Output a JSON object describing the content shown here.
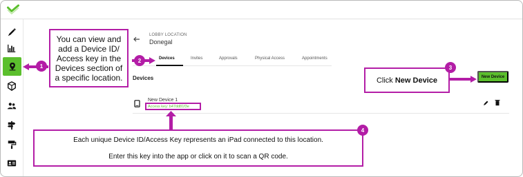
{
  "header": {
    "location_label": "LOBBY LOCATION",
    "location_name": "Donegal"
  },
  "tabs": [
    {
      "label": "Devices"
    },
    {
      "label": "Invites"
    },
    {
      "label": "Approvals"
    },
    {
      "label": "Physical Access"
    },
    {
      "label": "Appointments"
    }
  ],
  "devices": {
    "section_title": "Devices",
    "new_button": "New Device",
    "items": [
      {
        "name": "New Device 1",
        "access_key": "Access key: b47dd81f3e"
      }
    ]
  },
  "callouts": {
    "one": {
      "number": "1",
      "text": "You can view and add a Device ID/ Access key in the Devices section of a specific location."
    },
    "two": {
      "number": "2"
    },
    "three": {
      "number": "3",
      "prefix": "Click ",
      "strong": "New Device"
    },
    "four": {
      "number": "4",
      "line1": "Each unique Device ID/Access Key represents an iPad connected to this location.",
      "line2": "Enter this key into the app or click on it to scan a QR code."
    }
  },
  "colors": {
    "accent_green": "#5bbf2d",
    "callout_magenta": "#b31da6"
  },
  "icons": [
    "logo-check-icon",
    "pencil-icon",
    "bar-chart-icon",
    "location-pin-icon",
    "cube-icon",
    "people-icon",
    "signpost-icon",
    "paint-roller-icon",
    "id-card-icon",
    "back-arrow-icon",
    "tablet-icon",
    "edit-icon",
    "trash-icon"
  ]
}
